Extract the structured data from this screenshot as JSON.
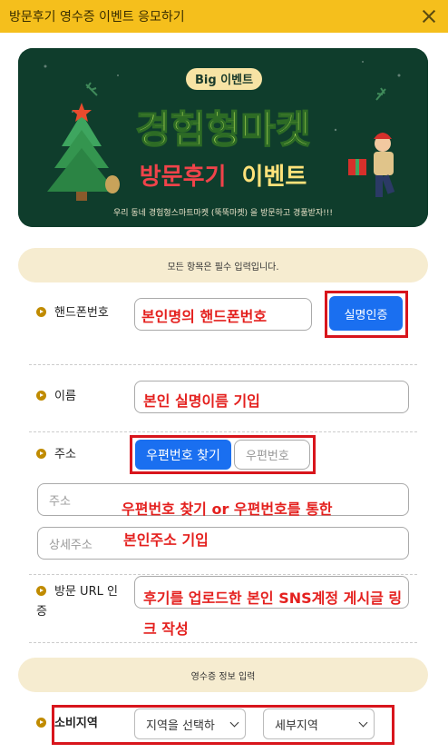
{
  "header": {
    "title": "방문후기 영수증 이벤트 응모하기"
  },
  "banner": {
    "badge": "Big 이벤트",
    "title": "경험형마켓",
    "subtitle_part1": "방문후기",
    "subtitle_part2": "이벤트",
    "caption": "우리 동네 경험형스마트마켓 (뚝뚝마켓) 을 방문하고 경품받자!!!"
  },
  "notice1": "모든 항목은 필수 입력입니다.",
  "phone": {
    "label": "핸드폰번호",
    "annotation": "본인명의 핸드폰번호",
    "verify_button": "실명인증"
  },
  "name": {
    "label": "이름",
    "annotation": "본인 실명이름 기입"
  },
  "address": {
    "label": "주소",
    "find_button": "우편번호 찾기",
    "postcode_placeholder": "우편번호",
    "address_placeholder": "주소",
    "detail_placeholder": "상세주소",
    "annotation_line1": "우편번호 찾기 or 우편번호를 통한",
    "annotation_line2": "본인주소 기입"
  },
  "url": {
    "label": "방문 URL 인증",
    "annotation_line1": "후기를 업로드한 본인 SNS계정 게시글 링",
    "annotation_line2": "크 작성"
  },
  "notice2": "영수증 정보 입력",
  "region": {
    "label": "소비지역",
    "region_select": "지역을 선택하",
    "subregion_select": "세부지역"
  }
}
